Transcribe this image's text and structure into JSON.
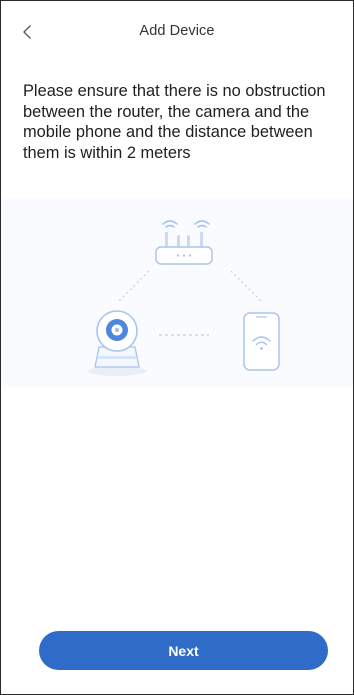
{
  "header": {
    "title": "Add Device",
    "back_icon": "chevron-left-icon"
  },
  "instruction": {
    "text": "Please ensure that there is no obstruction between the router, the camera and the mobile phone and the distance between them is within 2 meters"
  },
  "illustration": {
    "icons": [
      "router-icon",
      "camera-icon",
      "phone-icon"
    ],
    "accent_color": "#a9c4ee"
  },
  "footer": {
    "next_label": "Next",
    "button_color": "#2e6cc7"
  }
}
